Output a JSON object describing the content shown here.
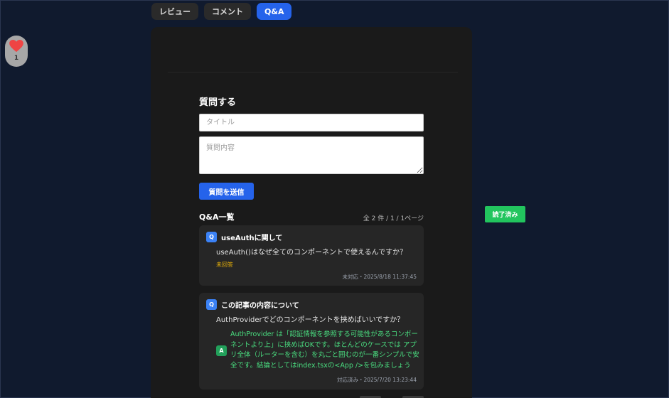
{
  "tabs": [
    {
      "label": "レビュー",
      "active": false
    },
    {
      "label": "コメント",
      "active": false
    },
    {
      "label": "Q&A",
      "active": true
    }
  ],
  "like": {
    "icon": "heart-icon",
    "count": "1",
    "color": "#ef4444"
  },
  "question_form": {
    "heading": "質問する",
    "title_placeholder": "タイトル",
    "body_placeholder": "質問内容",
    "submit_label": "質問を送信"
  },
  "qa_list": {
    "heading": "Q&A一覧",
    "pagination": "全 2 件 / 1 / 1ページ",
    "items": [
      {
        "badge": "Q",
        "title": "useAuthに関して",
        "body": "useAuth()はなぜ全てのコンポーネントで使えるんですか？",
        "status": "未回答",
        "meta": "未対応・2025/8/18 11:37:45"
      },
      {
        "badge": "Q",
        "title": "この記事の内容について",
        "body": "AuthProviderでどのコンポーネントを挟めばいいですか？",
        "answer_badge": "A",
        "answer": "AuthProvider は「認証情報を参照する可能性があるコンポーネントより上」に挟めばOKです。ほとんどのケースでは アプリ全体（ルーターを含む）を丸ごと囲むのが一番シンプルで安全です。結論としてはindex.tsxの<App />を包みましょう",
        "meta": "対応済み・2025/7/20 13:23:44"
      }
    ]
  },
  "complete_button": {
    "label": "読了済み",
    "color": "#22c55e"
  },
  "colors": {
    "accent": "#2563eb",
    "background": "#101a2e",
    "panel": "#1a1a1a",
    "card": "#262626",
    "answer": "#4ade80",
    "unanswered": "#eab308"
  }
}
